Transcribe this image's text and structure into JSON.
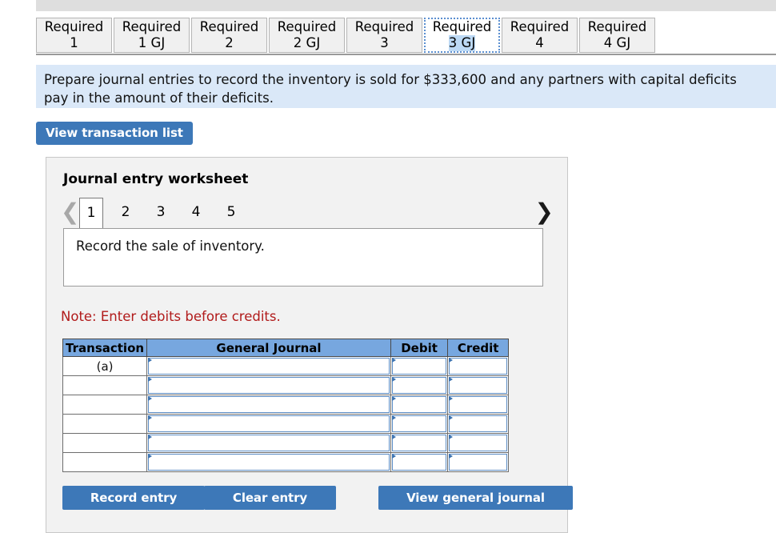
{
  "tabs": [
    {
      "line1": "Required",
      "line2": "1",
      "active": false
    },
    {
      "line1": "Required",
      "line2": "1 GJ",
      "active": false
    },
    {
      "line1": "Required",
      "line2": "2",
      "active": false
    },
    {
      "line1": "Required",
      "line2": "2 GJ",
      "active": false
    },
    {
      "line1": "Required",
      "line2": "3",
      "active": false
    },
    {
      "line1": "Required",
      "line2": "3 GJ",
      "active": true
    },
    {
      "line1": "Required",
      "line2": "4",
      "active": false
    },
    {
      "line1": "Required",
      "line2": "4 GJ",
      "active": false
    }
  ],
  "instruction": {
    "text": "Prepare journal entries to record the inventory is sold for $333,600 and any partners with capital deficits pay in the amount of their deficits."
  },
  "toolbar": {
    "view_transaction_list_label": "View transaction list"
  },
  "worksheet": {
    "title": "Journal entry worksheet",
    "pager": {
      "prev_icon": "chevron-left-icon",
      "next_icon": "chevron-right-icon",
      "pages": [
        "1",
        "2",
        "3",
        "4",
        "5"
      ],
      "current": "1"
    },
    "description": "Record the sale of inventory.",
    "note": "Note: Enter debits before credits.",
    "table": {
      "headers": [
        "Transaction",
        "General Journal",
        "Debit",
        "Credit"
      ],
      "rows": [
        {
          "transaction": "(a)",
          "general_journal": "",
          "debit": "",
          "credit": ""
        },
        {
          "transaction": "",
          "general_journal": "",
          "debit": "",
          "credit": ""
        },
        {
          "transaction": "",
          "general_journal": "",
          "debit": "",
          "credit": ""
        },
        {
          "transaction": "",
          "general_journal": "",
          "debit": "",
          "credit": ""
        },
        {
          "transaction": "",
          "general_journal": "",
          "debit": "",
          "credit": ""
        },
        {
          "transaction": "",
          "general_journal": "",
          "debit": "",
          "credit": ""
        }
      ]
    },
    "buttons": {
      "record_entry": "Record entry",
      "clear_entry": "Clear entry",
      "view_general_journal": "View general journal"
    }
  },
  "colors": {
    "button_blue": "#3d78b8",
    "instruction_bg": "#dae8f8",
    "table_header_blue": "#77a7df",
    "note_red": "#b11a1a",
    "panel_bg": "#f2f2f2",
    "top_strip": "#dedede"
  }
}
